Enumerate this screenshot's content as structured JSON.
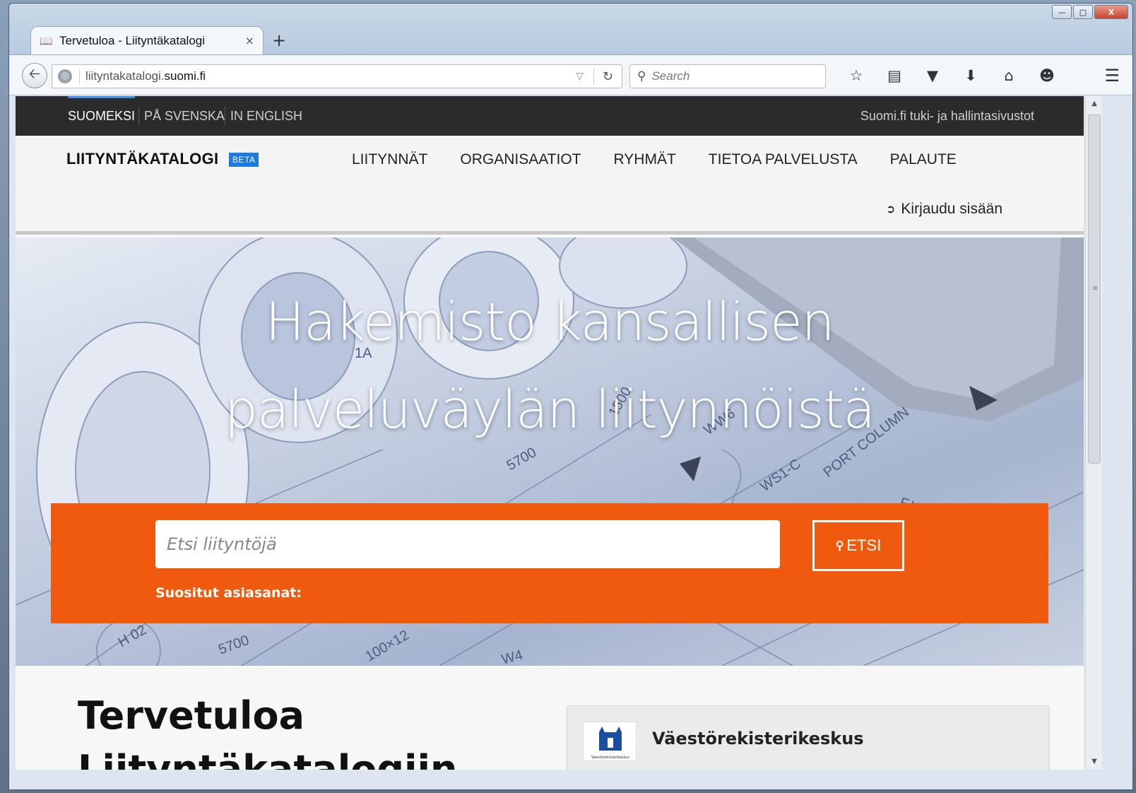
{
  "browser": {
    "tab_title": "Tervetuloa - Liityntäkatalogi",
    "tab_close": "×",
    "new_tab": "+",
    "url_prefix": "liityntakatalogi.",
    "url_domain": "suomi.fi",
    "search_placeholder": "Search",
    "window_minimize": "—",
    "window_maximize": "□",
    "window_close": "X",
    "icons": [
      "bookmark-star-icon",
      "reading-list-icon",
      "pocket-icon",
      "download-icon",
      "home-icon",
      "chat-icon",
      "hamburger-menu-icon"
    ]
  },
  "lang_bar": {
    "languages": [
      "SUOMEKSI",
      "PÅ SVENSKA",
      "IN ENGLISH"
    ],
    "active": "SUOMEKSI",
    "support_link": "Suomi.fi tuki- ja hallintasivustot"
  },
  "header": {
    "brand": "LIITYNTÄKATALOGI",
    "beta": "BETA",
    "nav": [
      "LIITYNNÄT",
      "ORGANISAATIOT",
      "RYHMÄT",
      "TIETOA PALVELUSTA",
      "PALAUTE"
    ],
    "login": "Kirjaudu sisään"
  },
  "hero": {
    "title_line1": "Hakemisto kansallisen",
    "title_line2": "palveluväylän liitynnöistä",
    "search_placeholder": "Etsi liityntöjä",
    "search_button": "ETSI",
    "popular_label": "Suositut asiasanat:",
    "drawing_labels": [
      "5700",
      "WW6",
      "WS1-C",
      "PORT COLUMN",
      "F.W.D.",
      "1A",
      "1500",
      "H 02",
      "5700",
      "100×12",
      "W4"
    ]
  },
  "content": {
    "welcome_title": "Tervetuloa",
    "welcome_title2": "Liityntäkatalogiin",
    "org_name": "Väestörekisterikeskus",
    "org_logo_caption": "Väestörekisterikeskus"
  },
  "colors": {
    "accent_orange": "#f05a0e",
    "beta_blue": "#1d7ae0",
    "topbar_dark": "#2b2b2b"
  }
}
